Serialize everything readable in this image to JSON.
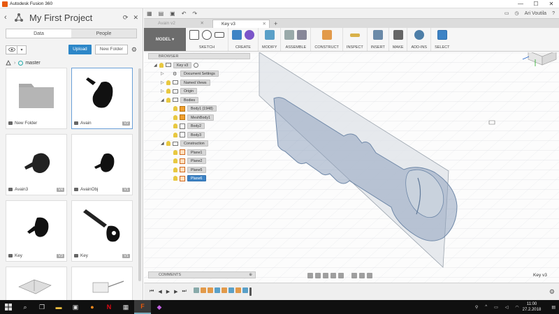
{
  "window": {
    "title": "Autodesk Fusion 360",
    "controls": [
      "—",
      "☐",
      "✕"
    ]
  },
  "data_panel": {
    "project_title": "My First Project",
    "tabs": [
      {
        "label": "Data",
        "active": true
      },
      {
        "label": "People",
        "active": false
      }
    ],
    "upload_label": "Upload",
    "new_folder_label": "New Folder",
    "branch": "master",
    "items": [
      {
        "label": "New Folder",
        "version": "",
        "kind": "folder"
      },
      {
        "label": "Avain",
        "version": "V2",
        "kind": "design"
      },
      {
        "label": "Avain3",
        "version": "V4",
        "kind": "design"
      },
      {
        "label": "AvainObj",
        "version": "V1",
        "kind": "design"
      },
      {
        "label": "Key",
        "version": "V3",
        "kind": "design"
      },
      {
        "label": "Key",
        "version": "V1",
        "kind": "design"
      }
    ]
  },
  "app_toolbar": {
    "user": "Ari Voutila"
  },
  "doc_tabs": [
    {
      "label": "Avain v2",
      "active": false
    },
    {
      "label": "Key v3",
      "active": true
    }
  ],
  "ribbon": {
    "workspace": "MODEL",
    "groups": [
      "SKETCH",
      "CREATE",
      "MODIFY",
      "ASSEMBLE",
      "CONSTRUCT",
      "INSPECT",
      "INSERT",
      "MAKE",
      "ADD-INS",
      "SELECT"
    ]
  },
  "browser": {
    "header": "BROWSER",
    "root": "Key v3",
    "rows": [
      {
        "label": "Document Settings",
        "depth": 1,
        "icon": "gear"
      },
      {
        "label": "Named Views",
        "depth": 1,
        "icon": "folder"
      },
      {
        "label": "Origin",
        "depth": 1,
        "icon": "folder"
      },
      {
        "label": "Bodies",
        "depth": 1,
        "icon": "folder"
      },
      {
        "label": "Body1 (1948)",
        "depth": 2,
        "icon": "body-orange"
      },
      {
        "label": "MeshBody1",
        "depth": 2,
        "icon": "body-orange"
      },
      {
        "label": "Body2",
        "depth": 2,
        "icon": "body"
      },
      {
        "label": "Body3",
        "depth": 2,
        "icon": "body"
      },
      {
        "label": "Construction",
        "depth": 1,
        "icon": "folder"
      },
      {
        "label": "Plane1",
        "depth": 2,
        "icon": "plane"
      },
      {
        "label": "Plane2",
        "depth": 2,
        "icon": "plane"
      },
      {
        "label": "Plane5",
        "depth": 2,
        "icon": "plane"
      },
      {
        "label": "Plane6",
        "depth": 2,
        "icon": "plane",
        "selected": true
      }
    ]
  },
  "comments": {
    "label": "COMMENTS"
  },
  "status": {
    "document_name": "Key v3"
  },
  "taskbar": {
    "time": "11:00",
    "date": "27.2.2018"
  },
  "colors": {
    "accent": "#2d87c8",
    "selected": "#3d83c5",
    "workspace": "#6c6c6c",
    "key_mesh": "#6f88a8"
  }
}
